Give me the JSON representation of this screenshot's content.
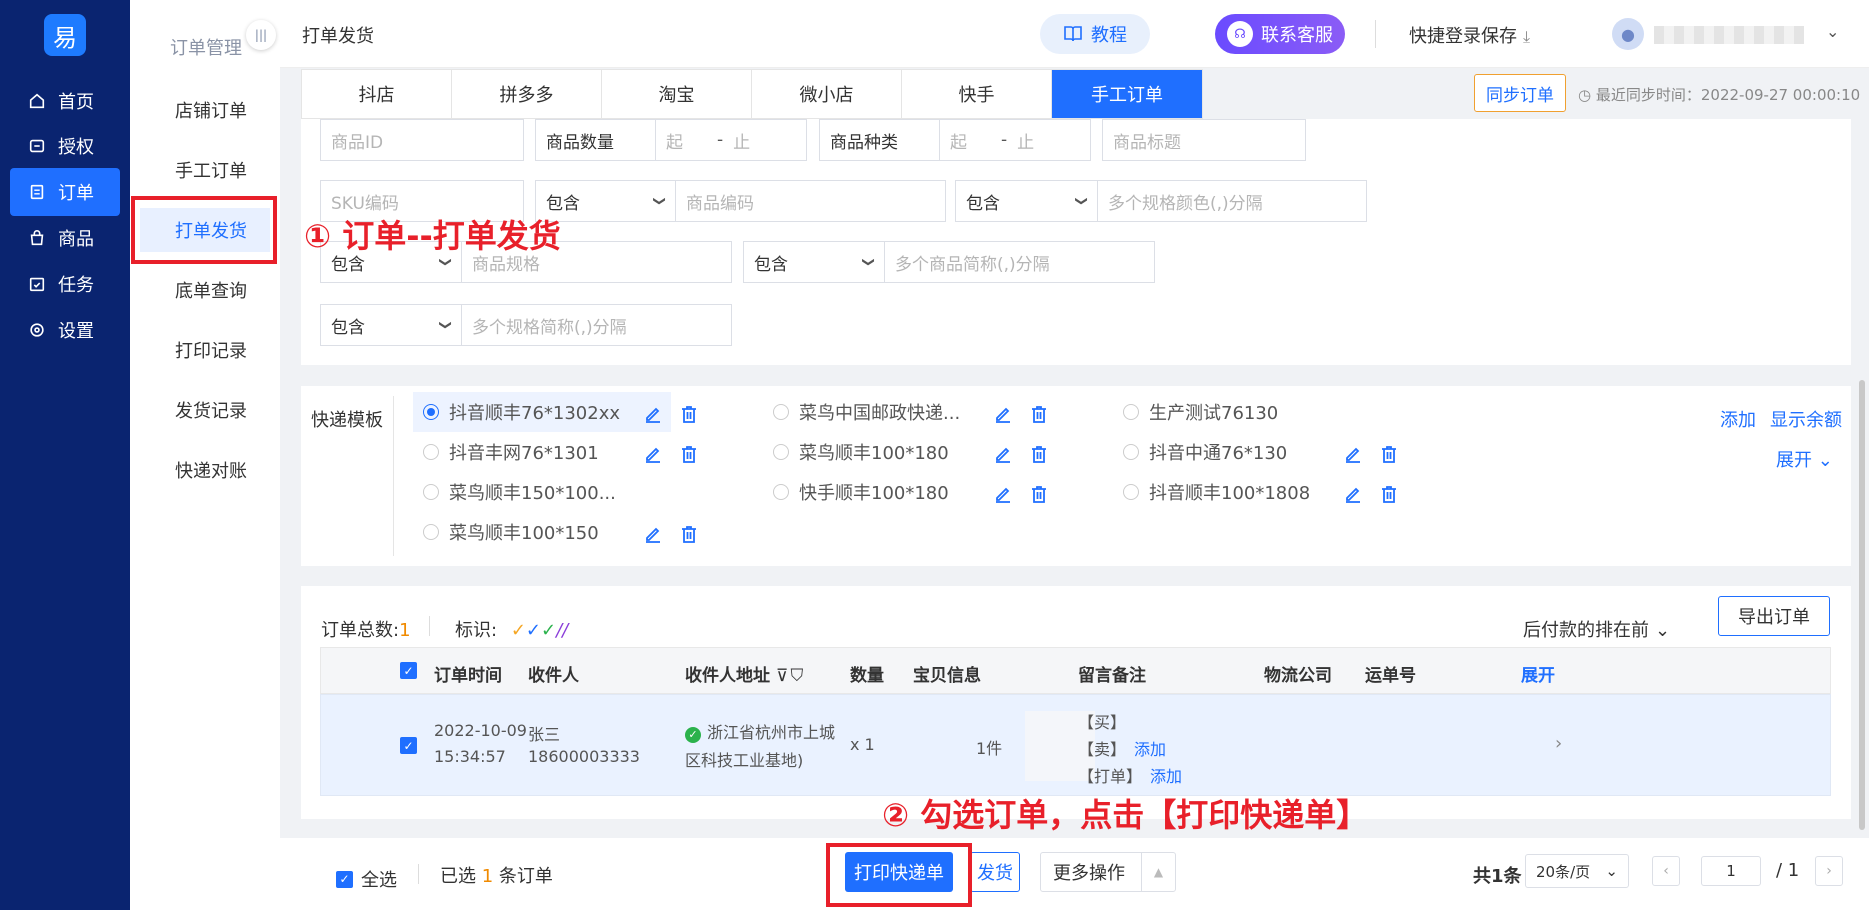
{
  "nav": {
    "logo": "易",
    "items": [
      {
        "label": "首页"
      },
      {
        "label": "授权"
      },
      {
        "label": "订单"
      },
      {
        "label": "商品"
      },
      {
        "label": "任务"
      },
      {
        "label": "设置"
      }
    ]
  },
  "submenu": {
    "title": "订单管理",
    "items": [
      {
        "label": "店铺订单"
      },
      {
        "label": "手工订单"
      },
      {
        "label": "打单发货"
      },
      {
        "label": "底单查询"
      },
      {
        "label": "打印记录"
      },
      {
        "label": "发货记录"
      },
      {
        "label": "快递对账"
      }
    ]
  },
  "header": {
    "title": "打单发货",
    "tutorial": "教程",
    "service": "联系客服",
    "quick_save": "快捷登录保存"
  },
  "tabs": [
    "抖店",
    "拼多多",
    "淘宝",
    "微小店",
    "快手",
    "手工订单"
  ],
  "sync": {
    "button": "同步订单",
    "time": "最近同步时间：2022-09-27 00:00:10"
  },
  "filters": {
    "product_id": "商品ID",
    "qty_label": "商品数量",
    "from": "起",
    "to": "止",
    "kind_label": "商品种类",
    "product_title": "商品标题",
    "sku_code": "SKU编码",
    "contains": "包含",
    "product_code": "商品编码",
    "spec_color": "多个规格颜色(,)分隔",
    "product_spec": "商品规格",
    "short_name": "多个商品简称(,)分隔",
    "spec_short": "多个规格简称(,)分隔"
  },
  "templates": {
    "label": "快递模板",
    "add": "添加",
    "balance": "显示余额",
    "expand": "展开",
    "items": [
      "抖音顺丰76*1302xx",
      "菜鸟中国邮政快递...",
      "生产测试76130",
      "抖音丰网76*1301",
      "菜鸟顺丰100*180",
      "抖音中通76*130",
      "菜鸟顺丰150*100...",
      "快手顺丰100*180",
      "抖音顺丰100*1808",
      "菜鸟顺丰100*150"
    ]
  },
  "orders": {
    "total_label": "订单总数:",
    "total": "1",
    "mark_label": "标识:",
    "sort": "后付款的排在前",
    "export": "导出订单",
    "columns": [
      "订单时间",
      "收件人",
      "收件人地址",
      "数量",
      "宝贝信息",
      "留言备注",
      "物流公司",
      "运单号",
      "展开"
    ],
    "rows": [
      {
        "date": "2022-10-09",
        "time": "15:34:57",
        "name": "张三",
        "phone": "18600003333",
        "address1": "浙江省杭州市上城",
        "address2": "区科技工业基地)",
        "qty": "x 1",
        "items": "1件",
        "note_buy": "【买】",
        "note_sell": "【卖】",
        "note_print": "【打单】",
        "add": "添加"
      }
    ]
  },
  "bottom": {
    "select_all": "全选",
    "selected_prefix": "已选",
    "selected_count": "1",
    "selected_suffix": "条订单",
    "print": "打印快递单",
    "ship": "发货",
    "more": "更多操作",
    "total": "共1条",
    "page_size": "20条/页",
    "page": "1",
    "pages": "/ 1"
  },
  "annotations": {
    "step1": "① 订单--打单发货",
    "step2": "② 勾选订单，点击【打印快递单】"
  },
  "colors": {
    "nav_bg": "#0a2470",
    "primary": "#1f6fff",
    "highlight": "#e8202a",
    "accent_orange": "#f08a00"
  }
}
